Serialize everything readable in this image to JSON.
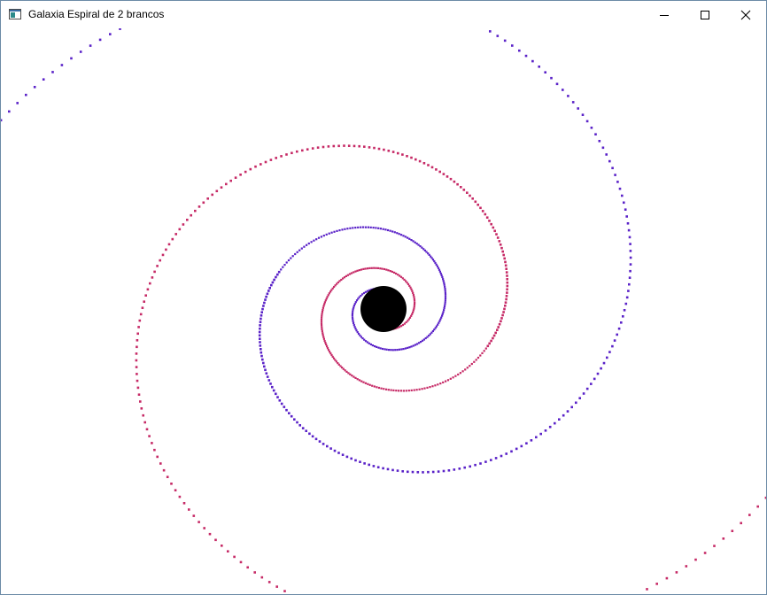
{
  "window": {
    "title": "Galaxia Espiral de 2 brancos",
    "app_icon": "console-window-icon",
    "controls": {
      "minimize_icon": "minimize-icon",
      "maximize_icon": "maximize-icon",
      "close_icon": "close-icon"
    }
  },
  "scene": {
    "background": "#ffffff",
    "core_color": "#000000",
    "arm_colors": {
      "arm_a": "#5a22c8",
      "arm_b": "#c62a66"
    }
  }
}
